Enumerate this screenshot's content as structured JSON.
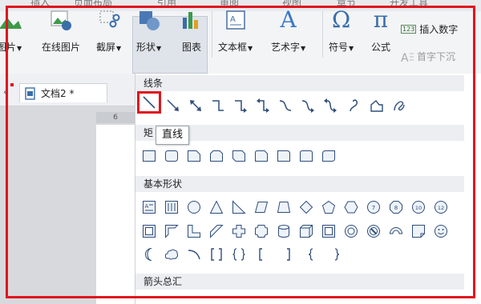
{
  "top_tabs": [
    "插入",
    "页面布局",
    "引用",
    "审阅",
    "视图",
    "章节",
    "开发工具"
  ],
  "ribbon": {
    "picture_label": "图片",
    "online_picture_label": "在线图片",
    "screenshot_label": "截屏",
    "shapes_label": "形状",
    "chart_label": "图表",
    "textbox_label": "文本框",
    "wordart_label": "艺术字",
    "symbol_label": "符号",
    "formula_label": "公式",
    "insert_number_label": "插入数字",
    "drop_cap_label": "首字下沉",
    "number_badge": "123",
    "wordart_glyph": "A",
    "symbol_glyph": "Ω",
    "formula_glyph": "π"
  },
  "document": {
    "tab_label": "文档2 *",
    "ruler_mark": "6"
  },
  "shapes_panel": {
    "sections": {
      "lines": "线条",
      "rectangles": "矩",
      "basic": "基本形状",
      "arrows": "箭头总汇"
    },
    "tooltip": "直线",
    "line_shapes": [
      "直线",
      "箭头",
      "双箭头",
      "肘形连接符",
      "肘形箭头连接符",
      "肘形双箭头连接符",
      "曲线连接符",
      "曲线箭头连接符",
      "曲线双箭头连接符",
      "曲线",
      "任意多边形",
      "自由曲线"
    ],
    "basic_badges": [
      "7",
      "8",
      "10",
      "12"
    ]
  },
  "colors": {
    "annotation_red": "#e0141e",
    "icon_blue": "#3a6ea8",
    "panel_header": "#eceef2"
  }
}
